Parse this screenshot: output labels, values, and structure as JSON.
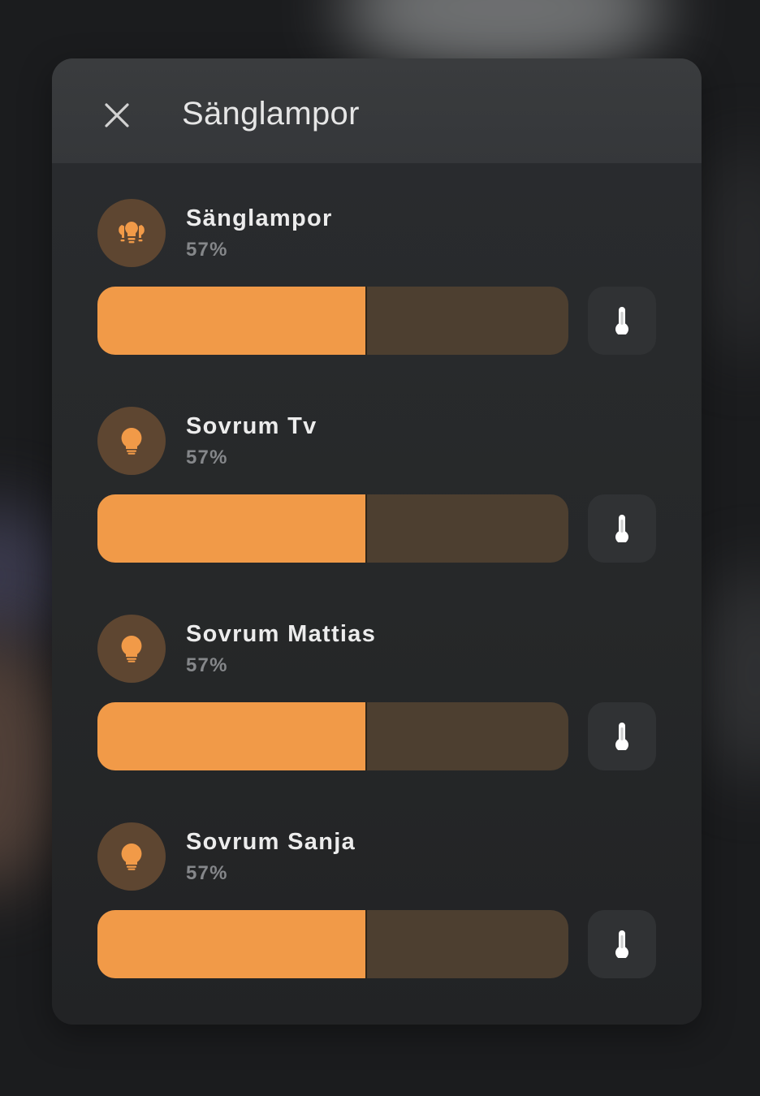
{
  "dialog": {
    "title": "Sänglampor",
    "close_icon": "close-icon"
  },
  "colors": {
    "accent": "#f19a48",
    "track": "#4d3f30",
    "icon_bg": "#5e4631"
  },
  "entities": [
    {
      "name": "Sänglampor",
      "state": "57%",
      "brightness": 57,
      "icon": "lightbulb-group-icon",
      "action_icon": "thermometer-icon"
    },
    {
      "name": "Sovrum Tv",
      "state": "57%",
      "brightness": 57,
      "icon": "lightbulb-icon",
      "action_icon": "thermometer-icon"
    },
    {
      "name": "Sovrum Mattias",
      "state": "57%",
      "brightness": 57,
      "icon": "lightbulb-icon",
      "action_icon": "thermometer-icon"
    },
    {
      "name": "Sovrum Sanja",
      "state": "57%",
      "brightness": 57,
      "icon": "lightbulb-icon",
      "action_icon": "thermometer-icon"
    }
  ]
}
